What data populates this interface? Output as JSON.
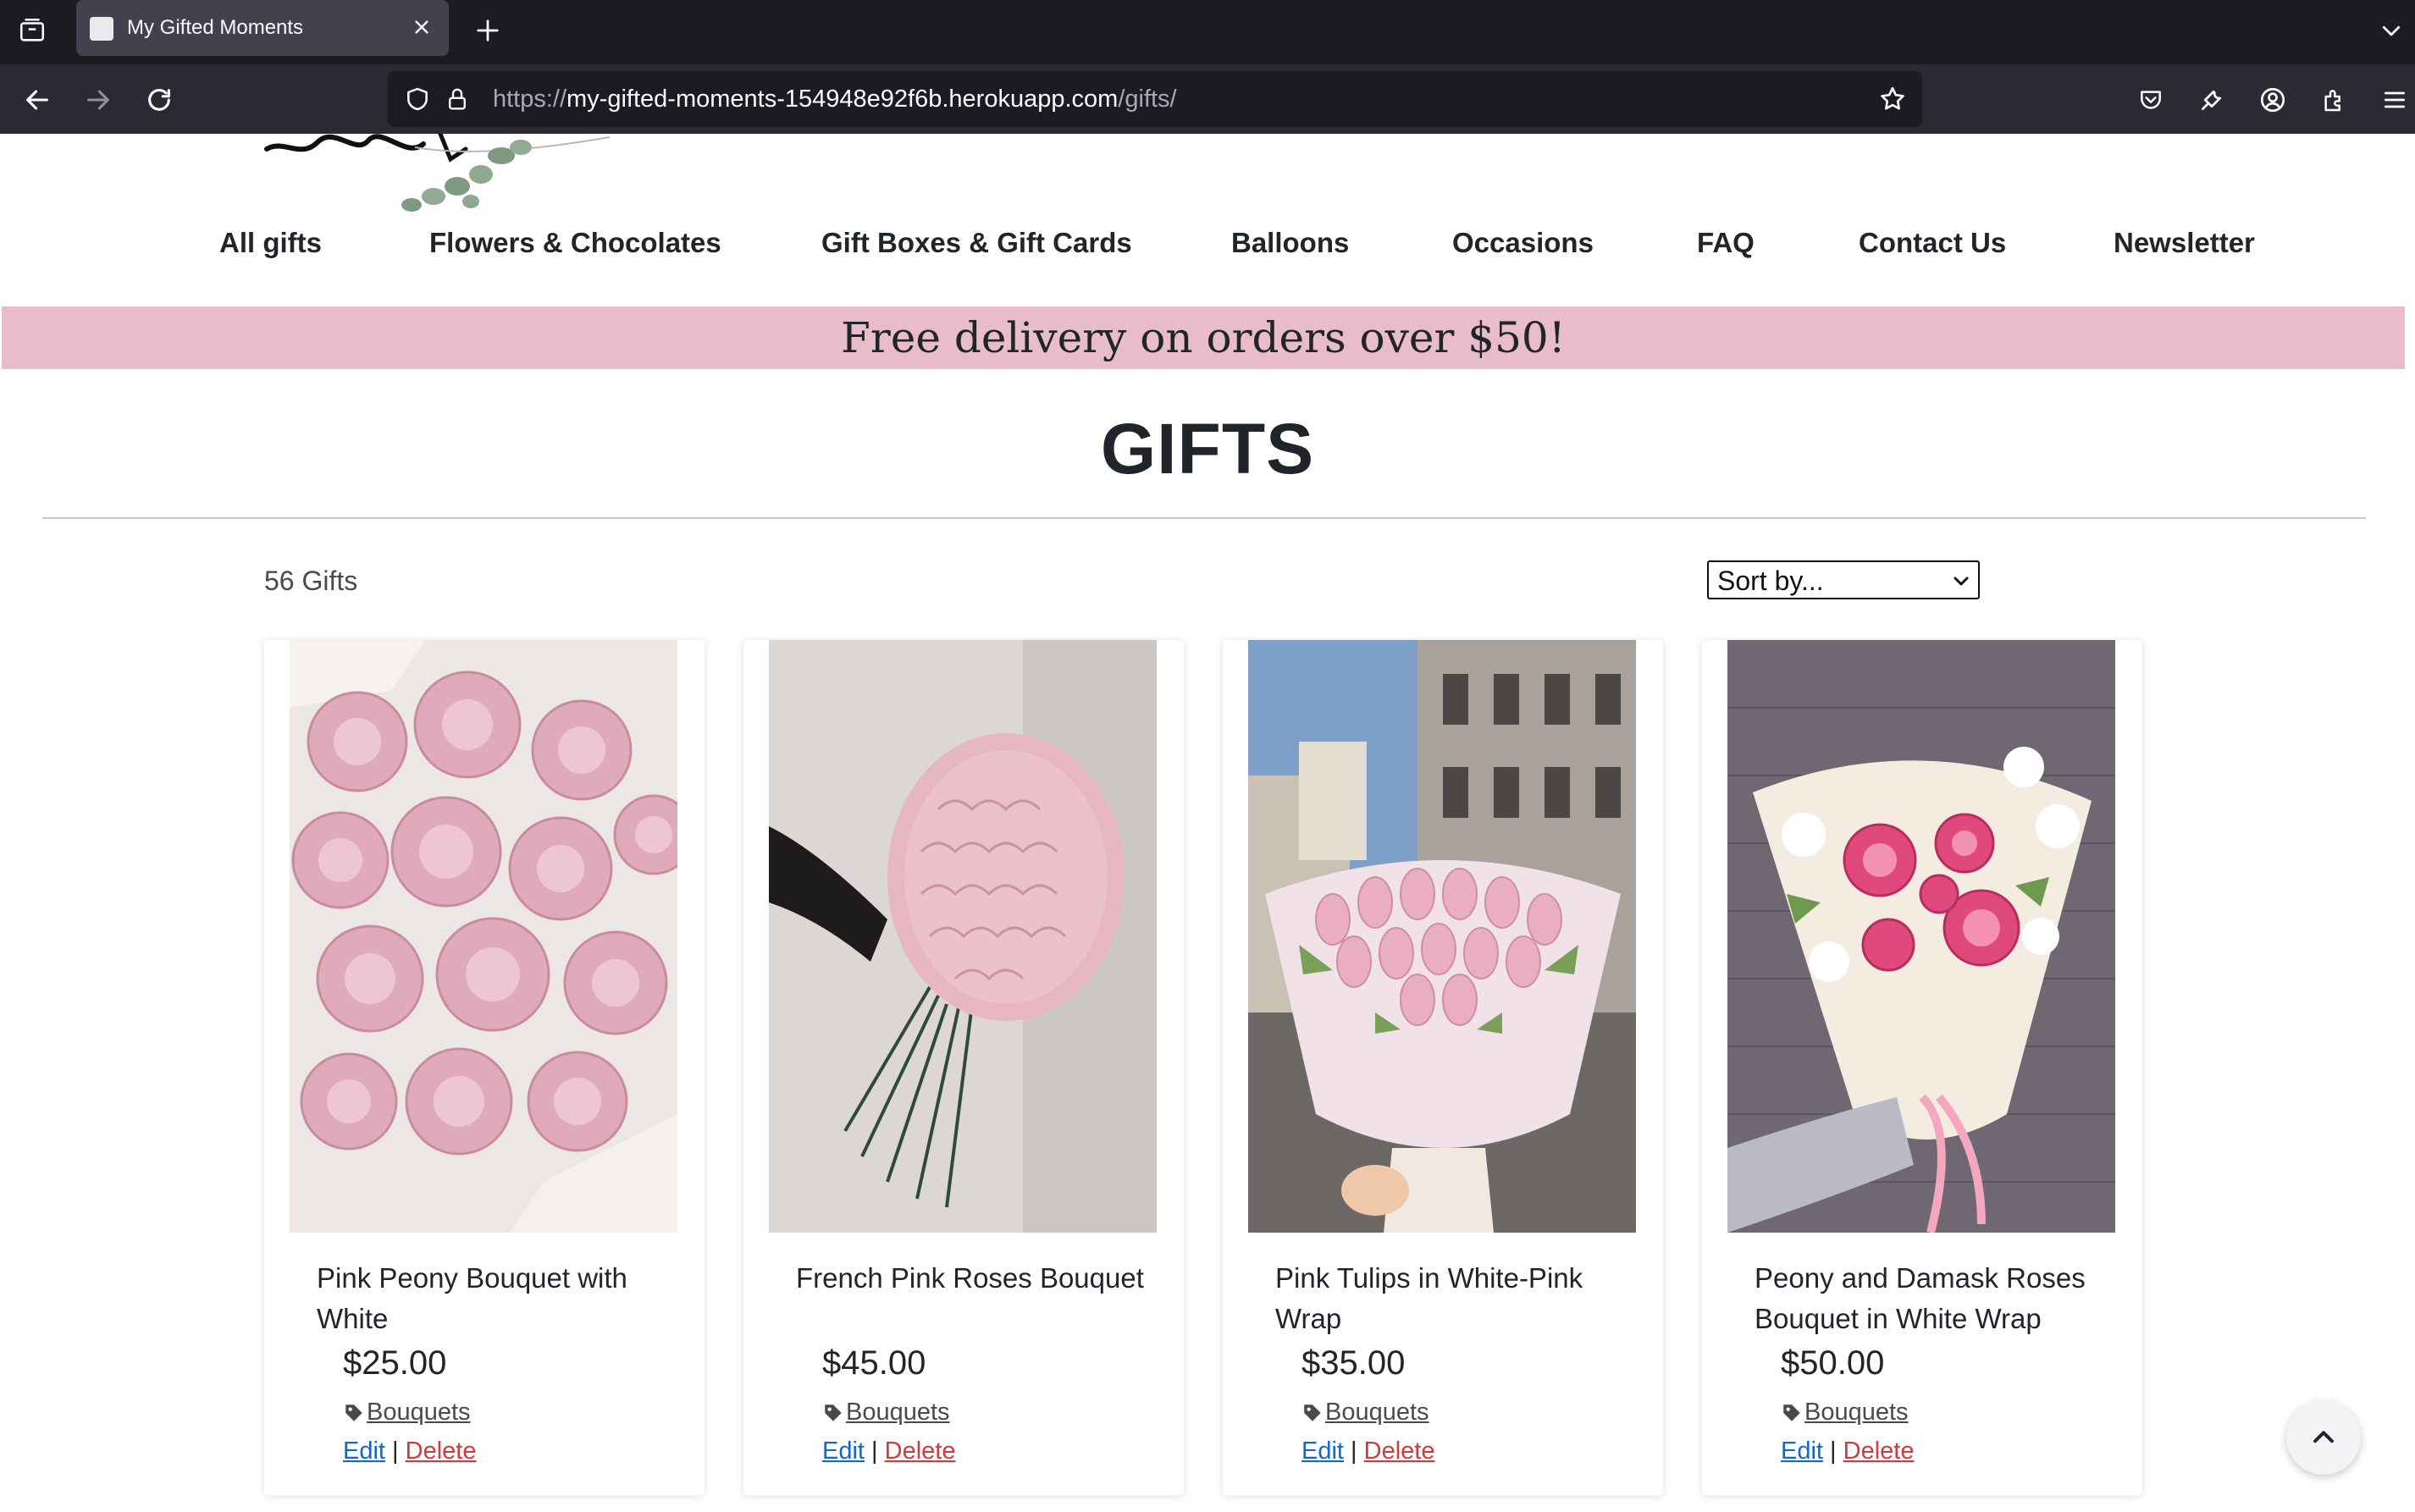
{
  "browser": {
    "tab": {
      "title": "My Gifted Moments"
    },
    "url": {
      "scheme": "https://",
      "host": "my-gifted-moments-154948e92f6b.herokuapp.com",
      "path": "/gifts/"
    }
  },
  "site": {
    "nav": [
      {
        "label": "All gifts"
      },
      {
        "label": "Flowers & Chocolates"
      },
      {
        "label": "Gift Boxes & Gift Cards"
      },
      {
        "label": "Balloons"
      },
      {
        "label": "Occasions"
      },
      {
        "label": "FAQ"
      },
      {
        "label": "Contact Us"
      },
      {
        "label": "Newsletter"
      }
    ],
    "banner": "Free delivery on orders over $50!"
  },
  "page": {
    "heading": "GIFTS",
    "count": "56 Gifts",
    "sort": {
      "selected": "Sort by..."
    }
  },
  "products": [
    {
      "title": "Pink Peony Bouquet with White",
      "price": "$25.00",
      "category": "Bouquets",
      "edit": "Edit",
      "sep": "|",
      "delete": "Delete"
    },
    {
      "title": "French Pink Roses Bouquet",
      "price": "$45.00",
      "category": "Bouquets",
      "edit": "Edit",
      "sep": "|",
      "delete": "Delete"
    },
    {
      "title": "Pink Tulips in White-Pink Wrap",
      "price": "$35.00",
      "category": "Bouquets",
      "edit": "Edit",
      "sep": "|",
      "delete": "Delete"
    },
    {
      "title": "Peony and Damask Roses Bouquet in White Wrap",
      "price": "$50.00",
      "category": "Bouquets",
      "edit": "Edit",
      "sep": "|",
      "delete": "Delete"
    }
  ],
  "colors": {
    "banner": "#e8bcc9",
    "edit_link": "#1266d4",
    "delete_link": "#d43838"
  }
}
